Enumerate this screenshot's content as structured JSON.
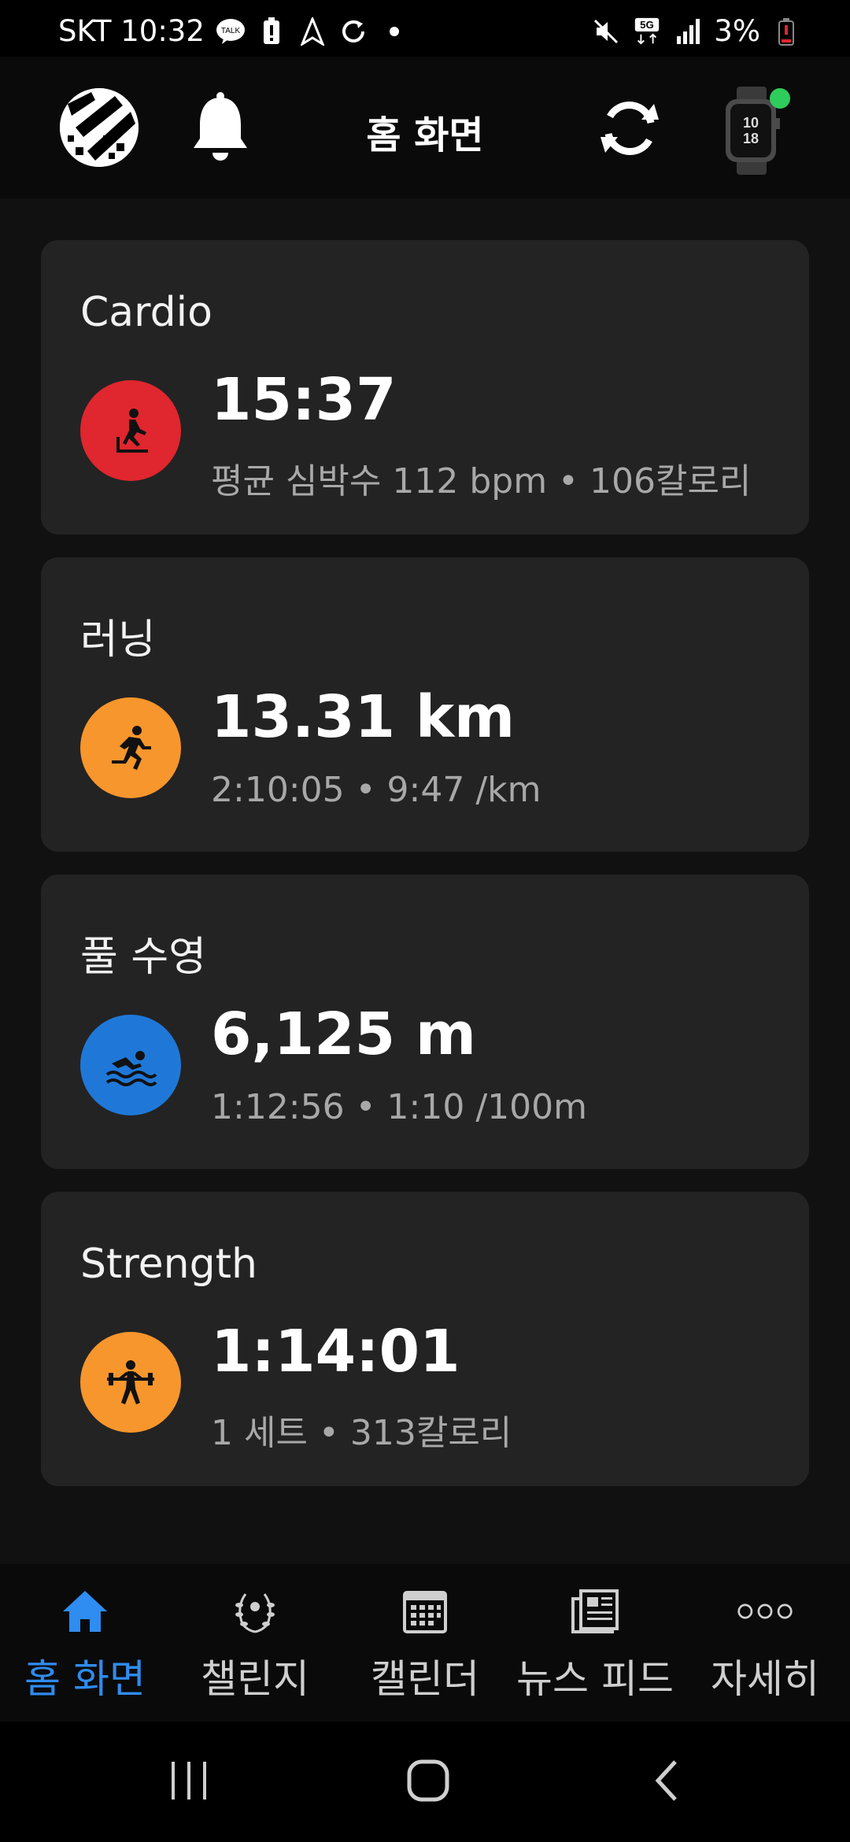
{
  "status_bar": {
    "carrier_time": "SKT 10:32",
    "talk_badge": "TALK",
    "network": "5G",
    "battery": "3%"
  },
  "app_bar": {
    "title": "홈 화면"
  },
  "cards": [
    {
      "title": "Cardio",
      "value": "15:37",
      "sub": "평균 심박수 112 bpm • 106칼로리",
      "icon": "treadmill-icon",
      "color": "#e0262e"
    },
    {
      "title": "러닝",
      "value": "13.31 km",
      "sub": "2:10:05 • 9:47 /km",
      "icon": "running-icon",
      "color": "#f7962c"
    },
    {
      "title": "풀 수영",
      "value": "6,125 m",
      "sub": "1:12:56 • 1:10 /100m",
      "icon": "swimming-icon",
      "color": "#1f78d8"
    },
    {
      "title": "Strength",
      "value": "1:14:01",
      "sub": "1 세트 • 313칼로리",
      "icon": "weightlifting-icon",
      "color": "#f7962c"
    }
  ],
  "bottom_nav": {
    "items": [
      {
        "label": "홈 화면",
        "icon": "home-icon",
        "active": true
      },
      {
        "label": "챌린지",
        "icon": "laurel-icon",
        "active": false
      },
      {
        "label": "캘린더",
        "icon": "calendar-icon",
        "active": false
      },
      {
        "label": "뉴스 피드",
        "icon": "newsfeed-icon",
        "active": false
      },
      {
        "label": "자세히",
        "icon": "more-icon",
        "active": false
      }
    ]
  },
  "colors": {
    "accent": "#2f8cf0",
    "background": "#111111",
    "card": "#232323",
    "connected": "#2ecc5b"
  }
}
